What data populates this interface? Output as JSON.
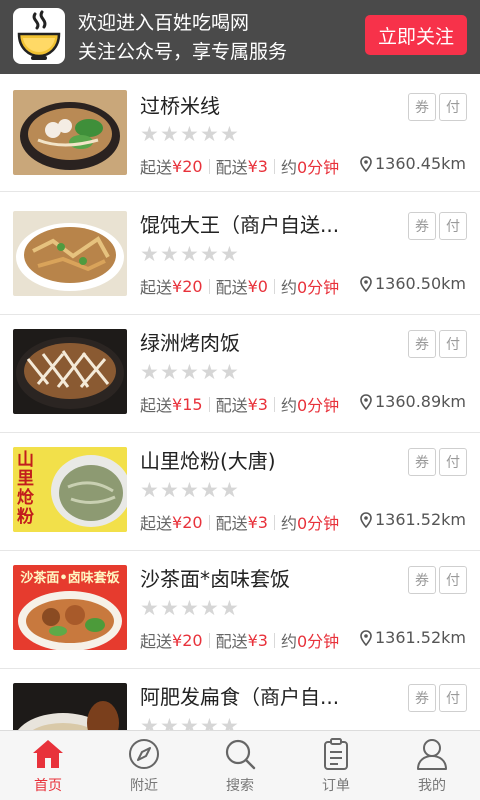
{
  "banner": {
    "line1": "欢迎进入百姓吃喝网",
    "line2": "关注公众号，享专属服务",
    "follow_label": "立即关注"
  },
  "colors": {
    "accent": "#e8323b",
    "banner_bg": "#4a4a4a",
    "star_empty": "#d6d6d6"
  },
  "labels": {
    "min_order": "起送",
    "delivery": "配送",
    "about": "约",
    "coupon_tag": "券",
    "pay_tag": "付"
  },
  "shops": [
    {
      "name": "过桥米线",
      "min_order": "¥20",
      "delivery_fee": "¥3",
      "time": "0分钟",
      "distance": "1360.45km",
      "rating": 0
    },
    {
      "name": "馄饨大王（商户自送...",
      "min_order": "¥20",
      "delivery_fee": "¥0",
      "time": "0分钟",
      "distance": "1360.50km",
      "rating": 0
    },
    {
      "name": "绿洲烤肉饭",
      "min_order": "¥15",
      "delivery_fee": "¥3",
      "time": "0分钟",
      "distance": "1360.89km",
      "rating": 0
    },
    {
      "name": "山里炝粉(大唐)",
      "min_order": "¥20",
      "delivery_fee": "¥3",
      "time": "0分钟",
      "distance": "1361.52km",
      "rating": 0
    },
    {
      "name": "沙茶面*卤味套饭",
      "min_order": "¥20",
      "delivery_fee": "¥3",
      "time": "0分钟",
      "distance": "1361.52km",
      "rating": 0
    },
    {
      "name": "阿肥发扁食（商户自...",
      "rating": 0
    }
  ],
  "thumb_text": {
    "shop4": "山里炝粉",
    "shop5": "沙茶面•卤味套饭"
  },
  "tabs": [
    {
      "label": "首页",
      "icon": "home-icon",
      "active": true
    },
    {
      "label": "附近",
      "icon": "compass-icon",
      "active": false
    },
    {
      "label": "搜索",
      "icon": "search-icon",
      "active": false
    },
    {
      "label": "订单",
      "icon": "order-icon",
      "active": false
    },
    {
      "label": "我的",
      "icon": "user-icon",
      "active": false
    }
  ]
}
